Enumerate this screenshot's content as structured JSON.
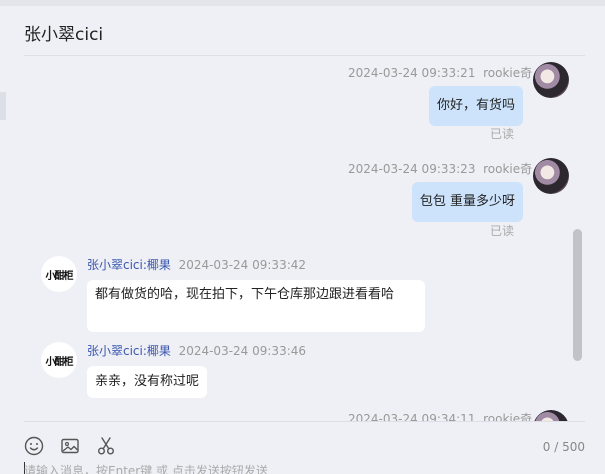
{
  "header": {
    "title": "张小翠cici"
  },
  "messages": [
    {
      "side": "right",
      "time": "2024-03-24 09:33:21",
      "sender": "rookie奇",
      "text": "你好，有货吗",
      "status": "已读"
    },
    {
      "side": "right",
      "time": "2024-03-24 09:33:23",
      "sender": "rookie奇",
      "text": "包包 重量多少呀",
      "status": "已读"
    },
    {
      "side": "left",
      "sender": "张小翠cici:椰果",
      "time": "2024-03-24 09:33:42",
      "text": "都有做货的哈，现在拍下，下午仓库那边跟进看看哈",
      "avatar_text": "小酣柜"
    },
    {
      "side": "left",
      "sender": "张小翠cici:椰果",
      "time": "2024-03-24 09:33:46",
      "text": "亲亲，没有称过呢",
      "avatar_text": "小酣柜"
    },
    {
      "side": "right",
      "time": "2024-03-24 09:34:11",
      "sender": "rookie奇"
    }
  ],
  "toolbar": {
    "icons": [
      "emoji-icon",
      "image-icon",
      "scissors-icon"
    ]
  },
  "input": {
    "placeholder": "请输入消息，按Enter键 或 点击发送按钮发送",
    "value": ""
  },
  "counter": "0 / 500",
  "colors": {
    "bubble_self": "#cde3fb",
    "bubble_other": "#ffffff",
    "background": "#eef0f5",
    "sender_link": "#3a56b0"
  }
}
